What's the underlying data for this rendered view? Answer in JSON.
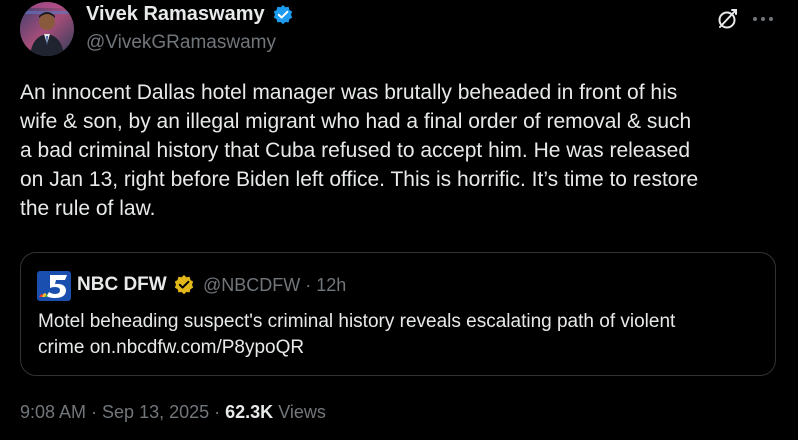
{
  "author": {
    "name": "Vivek Ramaswamy",
    "handle": "@VivekGRamaswamy",
    "avatar": "profile-photo",
    "verified_color": "#1d9bf0"
  },
  "actions": {
    "grok_icon": "grok-icon",
    "more_icon": "more-dots-icon"
  },
  "tweet": {
    "lines": [
      "An innocent Dallas hotel manager was brutally beheaded in front of his",
      "wife & son, by an illegal migrant who had a final order of removal & such",
      "a bad criminal history that Cuba refused to accept him. He was released",
      "on Jan 13, right before Biden left office. This is horrific. It’s time to restore",
      "the rule of law."
    ]
  },
  "quote": {
    "logo": "nbc-5-logo",
    "name": "NBC DFW",
    "handle_time": "@NBCDFW · 12h",
    "verified_color": "#e2b719",
    "lines": [
      "Motel beheading suspect's criminal history reveals escalating path of violent",
      "crime on.nbcdfw.com/P8ypoQR"
    ]
  },
  "meta": {
    "timestamp": "9:08 AM · Sep 13, 2025 · ",
    "views_count": "62.3K",
    "views_label": " Views"
  },
  "colors": {
    "background": "#000000",
    "text_primary": "#e7e9ea",
    "text_secondary": "#71767b",
    "border": "#2f3336"
  }
}
